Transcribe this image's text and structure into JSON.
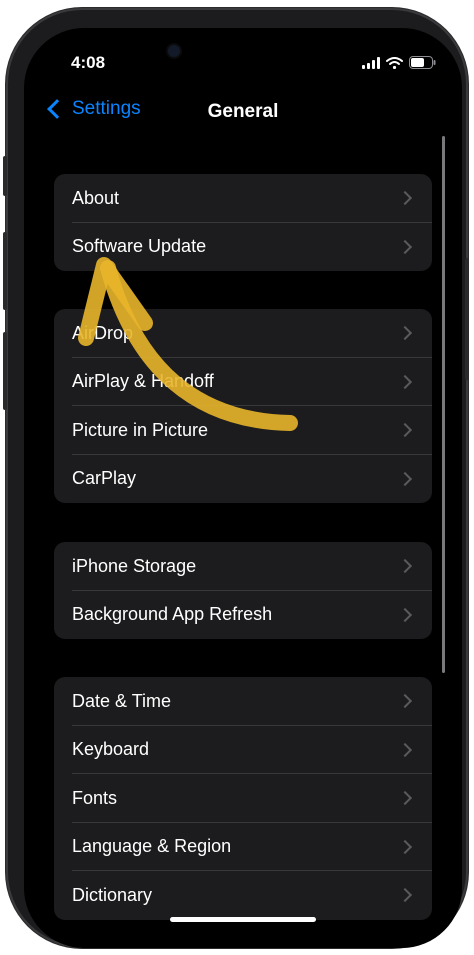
{
  "status_bar": {
    "time": "4:08"
  },
  "nav": {
    "back_label": "Settings",
    "title": "General"
  },
  "groups": [
    {
      "items": [
        {
          "label": "About"
        },
        {
          "label": "Software Update"
        }
      ]
    },
    {
      "items": [
        {
          "label": "AirDrop"
        },
        {
          "label": "AirPlay & Handoff"
        },
        {
          "label": "Picture in Picture"
        },
        {
          "label": "CarPlay"
        }
      ]
    },
    {
      "items": [
        {
          "label": "iPhone Storage"
        },
        {
          "label": "Background App Refresh"
        }
      ]
    },
    {
      "items": [
        {
          "label": "Date & Time"
        },
        {
          "label": "Keyboard"
        },
        {
          "label": "Fonts"
        },
        {
          "label": "Language & Region"
        },
        {
          "label": "Dictionary"
        }
      ]
    }
  ],
  "colors": {
    "accent": "#0a84ff",
    "annotation_arrow": "#e8b52a"
  },
  "icons": [
    "back-chevron-icon",
    "signal-icon",
    "wifi-icon",
    "battery-icon",
    "chevron-right-icon",
    "highlight-arrow-icon"
  ]
}
